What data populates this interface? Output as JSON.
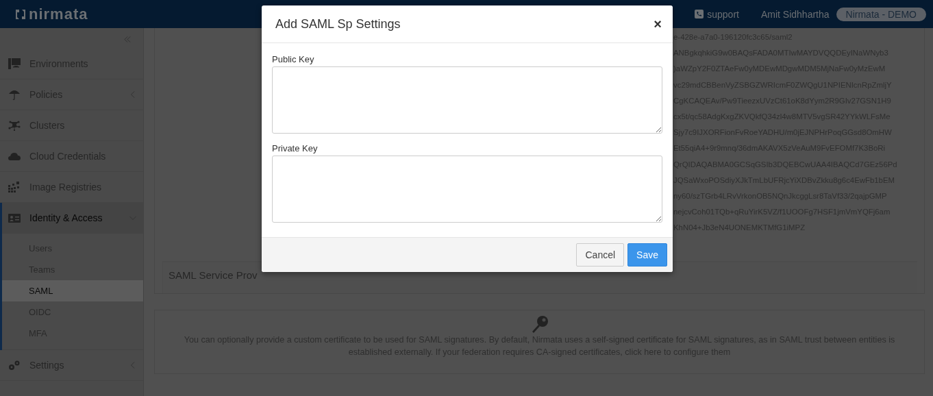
{
  "header": {
    "logo": "nirmata",
    "support": "support",
    "user": "Amit Sidhhartha",
    "tenant": "Nirmata - DEMO"
  },
  "sidebar": {
    "items": [
      {
        "label": "Environments"
      },
      {
        "label": "Policies",
        "expanded": false
      },
      {
        "label": "Clusters"
      },
      {
        "label": "Cloud Credentials"
      },
      {
        "label": "Image Registries"
      },
      {
        "label": "Identity & Access",
        "expanded": true,
        "children": [
          {
            "label": "Users",
            "selected": false
          },
          {
            "label": "Teams",
            "selected": false
          },
          {
            "label": "SAML",
            "selected": true
          },
          {
            "label": "OIDC",
            "selected": false
          },
          {
            "label": "MFA",
            "selected": false
          }
        ]
      },
      {
        "label": "Settings",
        "expanded": false
      }
    ]
  },
  "saml_panel": {
    "certificate_lines": [
      "e-428e-a7a0-196120fc3c65/saml2",
      "ANBgkqhkiG9w0BAQsFADA0MTIwMAYDVQQDEyINaWNyb3",
      ")aWZpY2F0ZTAeFw0yMDEwMDgwMDM5MjNaFw0yMzEwM",
      "vc29mdCBBenVyZSBGZWRIcmF0ZWQgU1NPIENIcnRpZmljY",
      "CgKCAQEAv/Pw9TieezxUVzCt61oK8dYym2R9GIv27GSN1H9",
      "cx5t/qc58AdgKxgZKVQkfQ34zl4w8MTV5vgSR42YYkWLFsMe",
      "Sjy7c9IJXORFionFvRoeYADHU/m0jEJNPHrPoqGGsd8OmHW",
      "Et55qiA4+9r9mnq/36dmAKAVX5zVeAuM9FvEFOMf7K3BoRi",
      "QrQIDAQABMA0GCSqGSIb3DQEBCwUAA4IBAQCd7GEz56Pd",
      "JQSaWxoPOSdiyXJkTmLbUFRjcYiXDBvZkku8g6c4EwFb1bEM",
      "ny60/szTGrb4LRvVrkonOB5NQnJkcggLsr8TaVf33/2qajpGMP",
      "nejcvCoh01TQb+qRuYirK5VZ/f1UOOFg7HSF1jmVmYQFj6am",
      "KhN04+Jb3eN4UONEMKTMfG1iMPZ"
    ],
    "section_title": "SAML Service Prov"
  },
  "info_panel": {
    "text": "You can optionally provide a custom certificate to be used for SAML signatures. By default, Nirmata uses a self-signed certificate for SAML signatures, as in SAML trust between entities is established externally. If your federation requires CA-signed certificates, click here to configure them"
  },
  "modal": {
    "title": "Add SAML Sp Settings",
    "close": "×",
    "fields": [
      {
        "label": "Public Key"
      },
      {
        "label": "Private Key"
      }
    ],
    "buttons": [
      {
        "label": "Cancel",
        "kind": "default"
      },
      {
        "label": "Save",
        "kind": "primary"
      }
    ]
  }
}
